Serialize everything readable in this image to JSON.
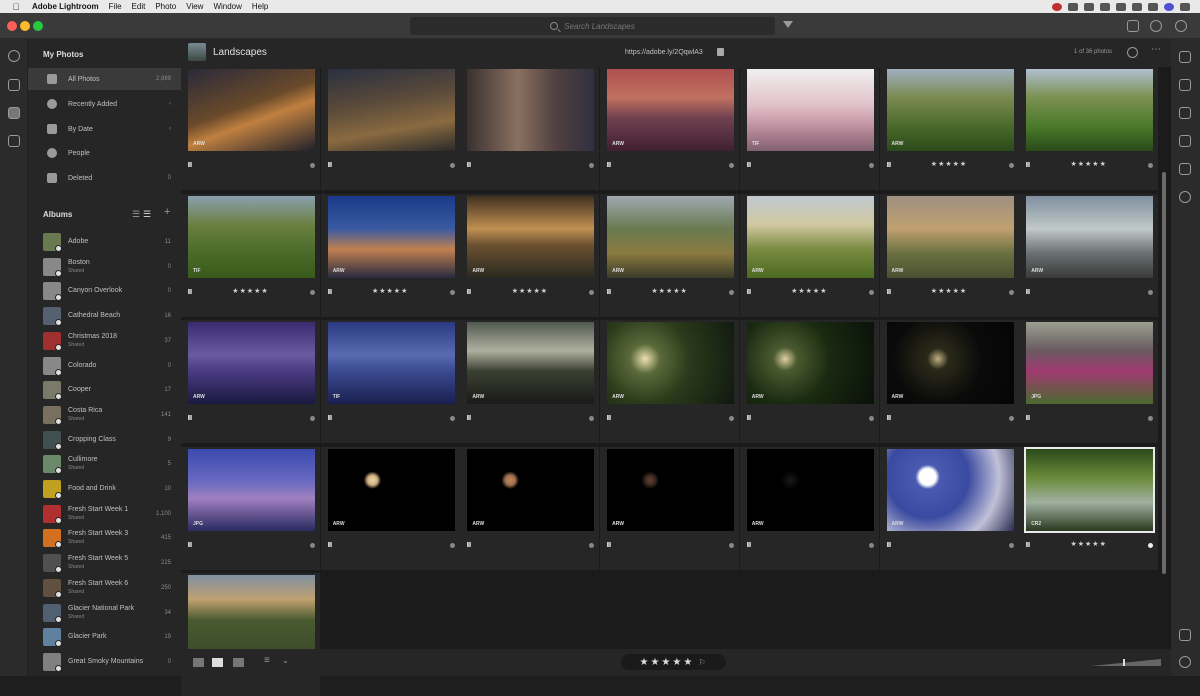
{
  "menubar": {
    "app_name": "Adobe Lightroom",
    "items": [
      "File",
      "Edit",
      "Photo",
      "View",
      "Window",
      "Help"
    ]
  },
  "search": {
    "placeholder": "Search Landscapes"
  },
  "sidebar": {
    "my_photos_heading": "My Photos",
    "items": [
      {
        "label": "All Photos",
        "count": "2,989",
        "selected": true
      },
      {
        "label": "Recently Added",
        "count": "",
        "chevron": true
      },
      {
        "label": "By Date",
        "count": "",
        "chevron": true
      },
      {
        "label": "People",
        "count": ""
      },
      {
        "label": "Deleted",
        "count": "0"
      }
    ],
    "albums_heading": "Albums",
    "albums": [
      {
        "name": "Adobe",
        "count": "11",
        "shared": "",
        "color": "#6a7a50"
      },
      {
        "name": "Boston",
        "count": "0",
        "shared": "Shared",
        "color": "#888"
      },
      {
        "name": "Canyon Overlook",
        "count": "0",
        "shared": "",
        "color": "#888"
      },
      {
        "name": "Cathedral Beach",
        "count": "16",
        "shared": "",
        "color": "#556070"
      },
      {
        "name": "Christmas 2018",
        "count": "37",
        "shared": "Shared",
        "color": "#a03030"
      },
      {
        "name": "Colorado",
        "count": "0",
        "shared": "",
        "color": "#888"
      },
      {
        "name": "Cooper",
        "count": "17",
        "shared": "",
        "color": "#7a7a6a"
      },
      {
        "name": "Costa Rica",
        "count": "141",
        "shared": "Shared",
        "color": "#7a7060"
      },
      {
        "name": "Cropping Class",
        "count": "9",
        "shared": "",
        "color": "#405050"
      },
      {
        "name": "Cullimore",
        "count": "5",
        "shared": "Shared",
        "color": "#6a8a6a"
      },
      {
        "name": "Food and Drink",
        "count": "10",
        "shared": "",
        "color": "#c0a020"
      },
      {
        "name": "Fresh Start Week 1",
        "count": "1,100",
        "shared": "Shared",
        "color": "#b03030"
      },
      {
        "name": "Fresh Start Week 3",
        "count": "415",
        "shared": "Shared",
        "color": "#d07020"
      },
      {
        "name": "Fresh Start Week 5",
        "count": "225",
        "shared": "Shared",
        "color": "#505050"
      },
      {
        "name": "Fresh Start Week 6",
        "count": "250",
        "shared": "Shared",
        "color": "#605040"
      },
      {
        "name": "Glacier National Park",
        "count": "34",
        "shared": "Shared",
        "color": "#506070"
      },
      {
        "name": "Glacier Park",
        "count": "19",
        "shared": "",
        "color": "#6080a0"
      },
      {
        "name": "Great Smoky Mountains",
        "count": "0",
        "shared": "",
        "color": "#808080"
      }
    ]
  },
  "content": {
    "album_title": "Landscapes",
    "share_link": "https://adobe.ly/2QqwlA3",
    "photo_count": "1 of 36 photos",
    "photos": [
      {
        "format": "ARW",
        "stars": "",
        "bg": "linear-gradient(160deg,#2a2a3a 0%,#6a4a2a 45%,#c08040 60%,#20202a 100%)"
      },
      {
        "format": "",
        "stars": "",
        "bg": "linear-gradient(170deg,#2a3040 0%,#5a4a3a 40%,#8a6a40 70%,#2a2a2a 100%)"
      },
      {
        "format": "",
        "stars": "",
        "bg": "linear-gradient(90deg,#3a3030 0%,#8a7060 40%,#504040 70%,#303040 100%)"
      },
      {
        "format": "ARW",
        "stars": "",
        "bg": "linear-gradient(180deg,#b05050 0%,#c07060 35%,#704050 60%,#402030 100%)"
      },
      {
        "format": "TIF",
        "stars": "",
        "bg": "linear-gradient(180deg,#f0f0f0 0%,#e0c0c8 45%,#c090a0 70%,#806070 100%)"
      },
      {
        "format": "ARW",
        "stars": "★★★★★",
        "bg": "linear-gradient(180deg,#a0b0c0 0%,#7a8a50 35%,#4a6a2a 70%,#2a4a1a 100%)"
      },
      {
        "format": "",
        "stars": "★★★★★",
        "bg": "linear-gradient(180deg,#b0c0d0 0%,#7a9050 35%,#4a7a2a 70%,#2a4a1a 100%)"
      },
      {
        "format": "TIF",
        "stars": "★★★★★",
        "bg": "linear-gradient(180deg,#8aa0b0 0%,#6a8040 35%,#4a6a2a 70%,#3a5a1a 100%)"
      },
      {
        "format": "ARW",
        "stars": "★★★★★",
        "bg": "linear-gradient(180deg,#1a3a8a 0%,#3a5aa0 40%,#c08050 65%,#2a2a40 100%)"
      },
      {
        "format": "ARW",
        "stars": "★★★★★",
        "bg": "linear-gradient(180deg,#403020 0%,#c09050 40%,#6a5030 60%,#2a2a20 100%)"
      },
      {
        "format": "ARW",
        "stars": "★★★★★",
        "bg": "linear-gradient(180deg,#a0a8b0 0%,#6a7a50 40%,#8a7a40 70%,#3a3a2a 100%)"
      },
      {
        "format": "ARW",
        "stars": "★★★★★",
        "bg": "linear-gradient(180deg,#c0c8d0 0%,#d0c8a0 35%,#7a8a40 65%,#4a6a20 100%)"
      },
      {
        "format": "ARW",
        "stars": "★★★★★",
        "bg": "linear-gradient(180deg,#a09080 0%,#c0a070 40%,#6a7040 70%,#4a5030 100%)"
      },
      {
        "format": "ARW",
        "stars": "",
        "bg": "linear-gradient(180deg,#8090a0 0%,#c0c8c8 40%,#6a7070 70%,#3a3a3a 100%)"
      },
      {
        "format": "ARW",
        "stars": "",
        "bg": "linear-gradient(180deg,#3a2a70 0%,#6a5aa0 40%,#4a3a80 60%,#1a1a40 100%)"
      },
      {
        "format": "TIF",
        "stars": "",
        "bg": "linear-gradient(180deg,#2a3a80 0%,#5a6ab0 40%,#3a4a90 60%,#1a2050 100%)"
      },
      {
        "format": "ARW",
        "stars": "",
        "bg": "linear-gradient(180deg,#505a50 0%,#b0b0a0 35%,#3a4030 60%,#1a1a1a 100%)"
      },
      {
        "format": "ARW",
        "stars": "",
        "bg": "radial-gradient(circle at 30% 45%,#f0e0b0 0%,#5a6a3a 15%,#2a3a1a 45%,#101810 100%)"
      },
      {
        "format": "ARW",
        "stars": "",
        "bg": "radial-gradient(circle at 30% 45%,#e0d0a0 0%,#4a5a30 12%,#1a2a10 45%,#0a100a 100%)"
      },
      {
        "format": "ARW",
        "stars": "",
        "bg": "radial-gradient(circle at 40% 45%,#c0b080 0%,#2a2a1a 12%,#0a0a0a 50%,#050505 100%)"
      },
      {
        "format": "JPG",
        "stars": "",
        "bg": "linear-gradient(180deg,#9aa090 0%,#6a5a60 35%,#a03a70 60%,#4a6a30 100%)"
      },
      {
        "format": "JPG",
        "stars": "",
        "bg": "linear-gradient(180deg,#3a4ab0 0%,#6a6ac0 40%,#a080c0 60%,#2a2a60 100%)"
      },
      {
        "format": "ARW",
        "stars": "",
        "bg": "radial-gradient(circle at 35% 38%,#f0d8b0 0%,#d0b080 5%,#000 9%,#000 100%)"
      },
      {
        "format": "ARW",
        "stars": "",
        "bg": "radial-gradient(circle at 34% 38%,#c08860 0%,#a07050 5%,#000 9%,#000 100%)"
      },
      {
        "format": "ARW",
        "stars": "",
        "bg": "radial-gradient(circle at 34% 38%,#6a4030 0%,#3a2a20 5%,#000 9%,#000 100%)"
      },
      {
        "format": "ARW",
        "stars": "",
        "bg": "radial-gradient(circle at 34% 38%,#1a1a1a 0%,#0a0a0a 6%,#000 10%,#000 100%)"
      },
      {
        "format": "ARW",
        "stars": "",
        "bg": "radial-gradient(circle at 32% 34%,#fff 0%,#fff 8%,#4a5ab0 12%,#3a4aa0 40%,#c0c0d8 70%,#2a2a50 100%)"
      },
      {
        "format": "CR2",
        "stars": "★★★★★",
        "bg": "linear-gradient(180deg,#2a4a1a 0%,#6a8a3a 35%,#a0b0a0 65%,#2a3a20 100%)",
        "selected": true
      },
      {
        "format": "",
        "stars": "",
        "bg": "linear-gradient(180deg,#8090a0 0%,#c0a070 30%,#4a5a30 55%,#3a4a2a 100%)"
      }
    ]
  },
  "bottombar": {
    "stars_filter": "★★★★★"
  }
}
